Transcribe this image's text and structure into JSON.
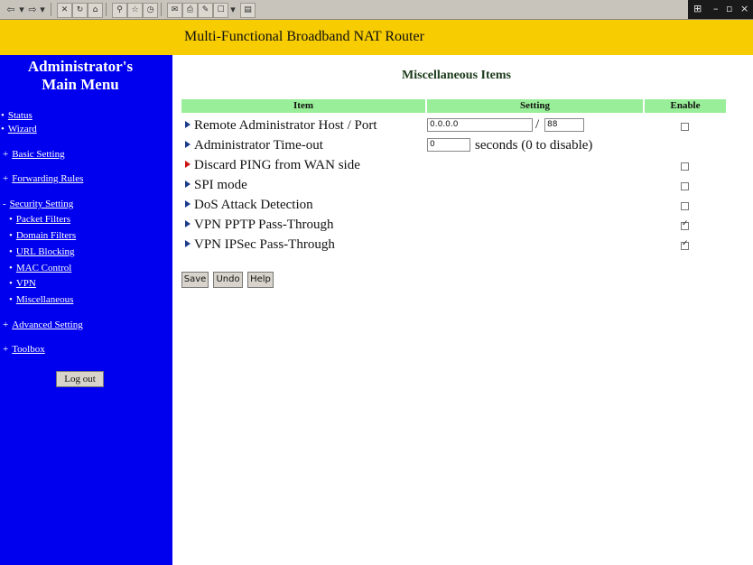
{
  "browser": {
    "toolbar_icons": [
      "back-arrow-icon",
      "forward-arrow-icon",
      "stop-icon",
      "refresh-icon",
      "home-icon",
      "search-icon",
      "favorites-icon",
      "history-icon",
      "mail-icon",
      "print-icon",
      "edit-icon"
    ],
    "window_controls": [
      "minimize-icon",
      "restore-icon",
      "close-icon"
    ]
  },
  "banner": {
    "title": "Multi-Functional Broadband NAT Router"
  },
  "sidebar": {
    "title_line1": "Administrator's",
    "title_line2": "Main Menu",
    "links": [
      {
        "label": "Status",
        "bullet": "•"
      },
      {
        "label": "Wizard",
        "bullet": "•"
      },
      {
        "label": "Basic Setting",
        "bullet": "+"
      },
      {
        "label": "Forwarding Rules",
        "bullet": "+"
      },
      {
        "label": "Security Setting",
        "bullet": "-"
      },
      {
        "label": "Packet Filters",
        "bullet": "•"
      },
      {
        "label": "Domain Filters",
        "bullet": "•"
      },
      {
        "label": "URL Blocking",
        "bullet": "•"
      },
      {
        "label": "MAC Control",
        "bullet": "•"
      },
      {
        "label": "VPN",
        "bullet": "•"
      },
      {
        "label": "Miscellaneous",
        "bullet": "•"
      },
      {
        "label": "Advanced Setting",
        "bullet": "+"
      },
      {
        "label": "Toolbox",
        "bullet": "+"
      }
    ],
    "logout_label": "Log out"
  },
  "main": {
    "title": "Miscellaneous Items",
    "columns": {
      "item": "Item",
      "setting": "Setting",
      "enable": "Enable"
    },
    "rows": [
      {
        "label": "Remote Administrator Host / Port",
        "enabled": false
      },
      {
        "label": "Administrator Time-out",
        "enabled": null
      },
      {
        "label": "Discard PING from WAN side",
        "enabled": false
      },
      {
        "label": "SPI mode",
        "enabled": false
      },
      {
        "label": "DoS Attack Detection",
        "enabled": false
      },
      {
        "label": "VPN PPTP Pass-Through",
        "enabled": true
      },
      {
        "label": "VPN IPSec Pass-Through",
        "enabled": true
      }
    ],
    "remote_host_value": "0.0.0.0",
    "separator": "/",
    "remote_port_value": "88",
    "timeout_value": "0",
    "timeout_suffix": "seconds (0 to disable)",
    "buttons": {
      "save": "Save",
      "undo": "Undo",
      "help": "Help"
    }
  }
}
